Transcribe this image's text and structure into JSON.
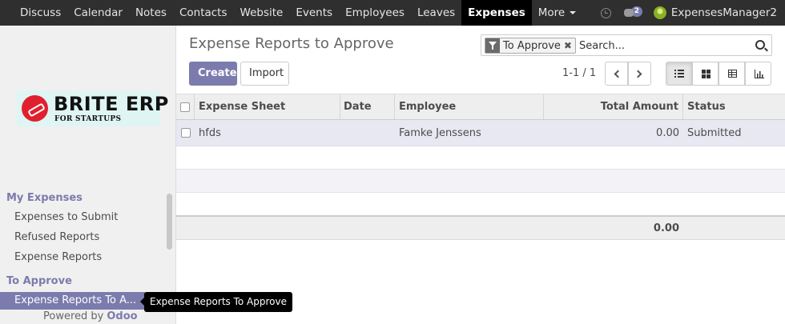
{
  "topbar": {
    "apps": [
      "Discuss",
      "Calendar",
      "Notes",
      "Contacts",
      "Website",
      "Events",
      "Employees",
      "Leaves",
      "Expenses"
    ],
    "more_label": "More",
    "active_app": "Expenses",
    "messages_count": "2",
    "user_name": "ExpensesManager2",
    "icons": [
      "clock-icon",
      "chat-icon",
      "avatar"
    ]
  },
  "sidebar": {
    "logo": {
      "title": "BRITE ERP",
      "subtitle": "FOR STARTUPS"
    },
    "sections": [
      {
        "title": "My Expenses",
        "items": [
          "Expenses to Submit",
          "Refused Reports",
          "Expense Reports"
        ]
      },
      {
        "title": "To Approve",
        "items": [
          "Expense Reports To A..."
        ]
      }
    ],
    "powered_by": "Powered by",
    "powered_brand": "Odoo"
  },
  "tooltip": "Expense Reports To Approve",
  "control_panel": {
    "title": "Expense Reports to Approve",
    "facet_label": "To Approve",
    "facet_remove": "✖",
    "search_placeholder": "Search...",
    "create_label": "Create",
    "import_label": "Import",
    "pager": "1-1 / 1",
    "views": [
      "list",
      "kanban",
      "grid",
      "graph"
    ],
    "active_view": "list"
  },
  "table": {
    "columns": [
      "Expense Sheet",
      "Date",
      "Employee",
      "Total Amount",
      "Status"
    ],
    "rows": [
      {
        "sheet": "hfds",
        "date": "",
        "employee": "Famke Jenssens",
        "amount": "0.00",
        "status": "Submitted"
      }
    ],
    "footer_total": "0.00"
  },
  "colors": {
    "accent": "#7c7bad",
    "topbar_bg": "#2f2f2f",
    "sidebar_bg": "#f0f0f0",
    "logo_red": "#e0202e"
  }
}
